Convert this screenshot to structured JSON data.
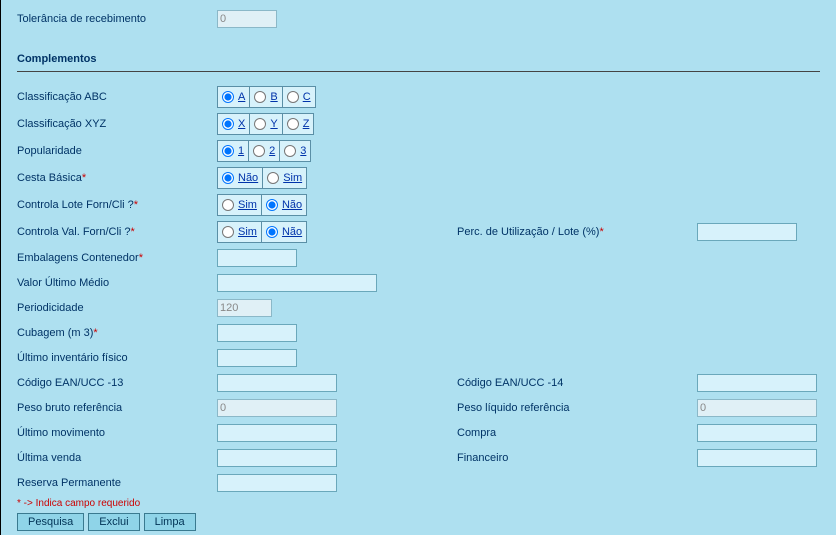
{
  "top": {
    "tolerancia_label": "Tolerância de recebimento",
    "tolerancia_value": "0"
  },
  "section_title": "Complementos",
  "rows": {
    "classif_abc": {
      "label": "Classificação ABC",
      "opts": [
        "A",
        "B",
        "C"
      ],
      "selected": 0
    },
    "classif_xyz": {
      "label": "Classificação XYZ",
      "opts": [
        "X",
        "Y",
        "Z"
      ],
      "selected": 0
    },
    "popularidade": {
      "label": "Popularidade",
      "opts": [
        "1",
        "2",
        "3"
      ],
      "selected": 0
    },
    "cesta_basica": {
      "label": "Cesta Básica",
      "req": true,
      "opts": [
        "Não",
        "Sim"
      ],
      "selected": 0
    },
    "controla_lote": {
      "label": "Controla Lote Forn/Cli ?",
      "req": true,
      "opts": [
        "Sim",
        "Não"
      ],
      "selected": 1
    },
    "controla_val": {
      "label": "Controla Val. Forn/Cli ?",
      "req": true,
      "opts": [
        "Sim",
        "Não"
      ],
      "selected": 1,
      "side_label": "Perc. de Utilização / Lote (%)",
      "side_req": true,
      "side_value": ""
    },
    "embalagens": {
      "label": "Embalagens Contenedor",
      "req": true,
      "value": ""
    },
    "valor_ultimo": {
      "label": "Valor Último Médio",
      "value": ""
    },
    "periodicidade": {
      "label": "Periodicidade",
      "value": "120"
    },
    "cubagem": {
      "label": "Cubagem (m 3)",
      "req": true,
      "value": ""
    },
    "ultimo_inv": {
      "label": "Último inventário físico",
      "value": ""
    },
    "ean13": {
      "label": "Código EAN/UCC -13",
      "value": "",
      "side_label": "Código EAN/UCC -14",
      "side_value": ""
    },
    "peso_bruto": {
      "label": "Peso bruto referência",
      "value": "0",
      "side_label": "Peso líquido referência",
      "side_value": "0"
    },
    "ultimo_mov": {
      "label": "Último movimento",
      "value": "",
      "side_label": "Compra",
      "side_value": ""
    },
    "ultima_venda": {
      "label": "Última venda",
      "value": "",
      "side_label": "Financeiro",
      "side_value": ""
    },
    "reserva": {
      "label": "Reserva Permanente",
      "value": ""
    }
  },
  "footer_note": "* -> Indica campo requerido",
  "buttons": {
    "pesquisa": "Pesquisa",
    "exclui": "Exclui",
    "limpa": "Limpa"
  }
}
